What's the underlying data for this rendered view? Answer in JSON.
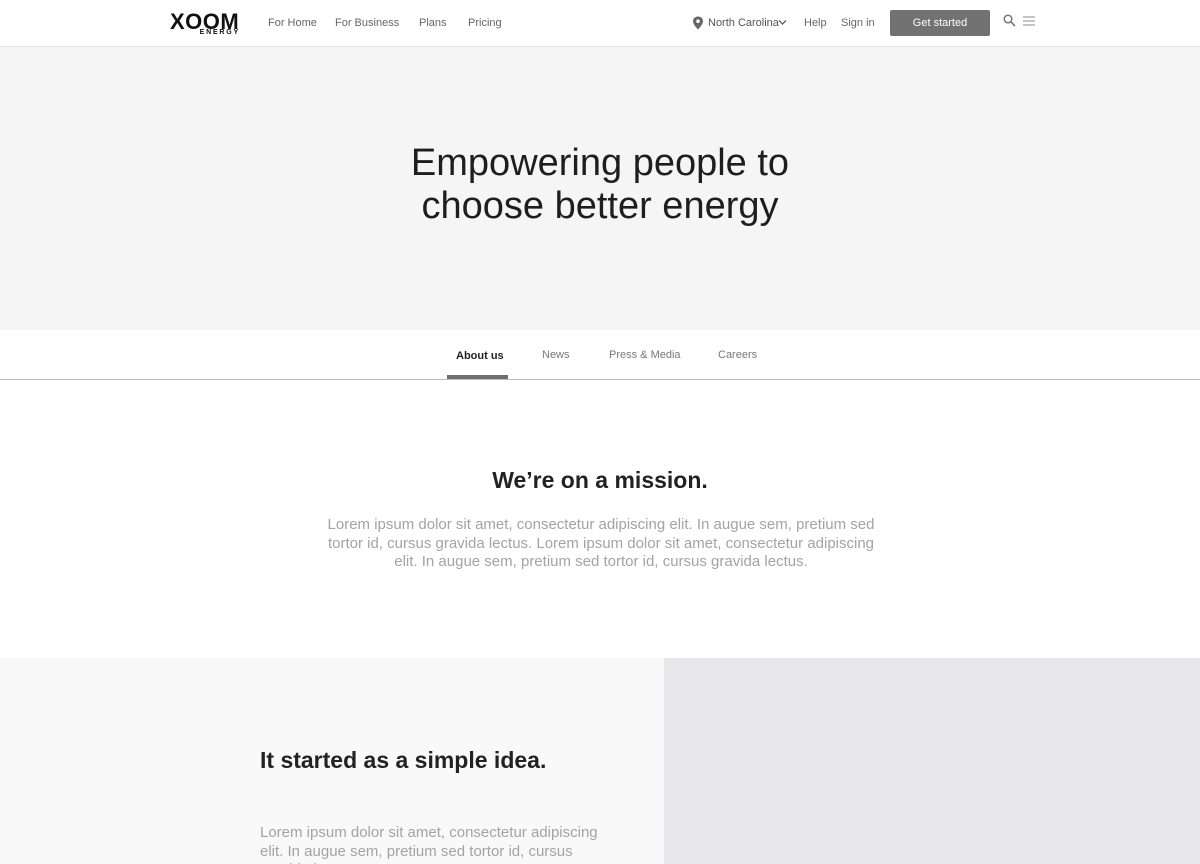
{
  "header": {
    "logo_main": "XOOM",
    "logo_sub": "ENERGY",
    "nav": [
      "For Home",
      "For Business",
      "Plans",
      "Pricing"
    ],
    "location": "North Carolina",
    "help": "Help",
    "sign_in": "Sign in",
    "cta": "Get started",
    "icons": [
      "location-pin-icon",
      "chevron-down-icon",
      "search-icon",
      "menu-icon"
    ]
  },
  "hero": {
    "title_line1": "Empowering people to",
    "title_line2": "choose better energy"
  },
  "tabs": [
    "About us",
    "News",
    "Press & Media",
    "Careers"
  ],
  "active_tab": "About us",
  "mission": {
    "title": "We’re on a mission.",
    "body": "Lorem ipsum dolor sit amet, consectetur adipiscing elit. In augue sem, pretium sed tortor id, cursus gravida lectus. Lorem ipsum dolor sit amet, consectetur adipiscing elit. In augue sem, pretium sed tortor id, cursus gravida lectus."
  },
  "story": {
    "title": "It started as a simple idea.",
    "body": "Lorem ipsum dolor sit amet, consectetur adipiscing elit. In augue sem, pretium sed tortor id, cursus gravida lectus."
  },
  "colors": {
    "cta_bg": "#727272",
    "hero_bg": "#f5f5f5",
    "body_text_muted": "#a3a3a3",
    "image_placeholder": "#e8e8ea"
  }
}
